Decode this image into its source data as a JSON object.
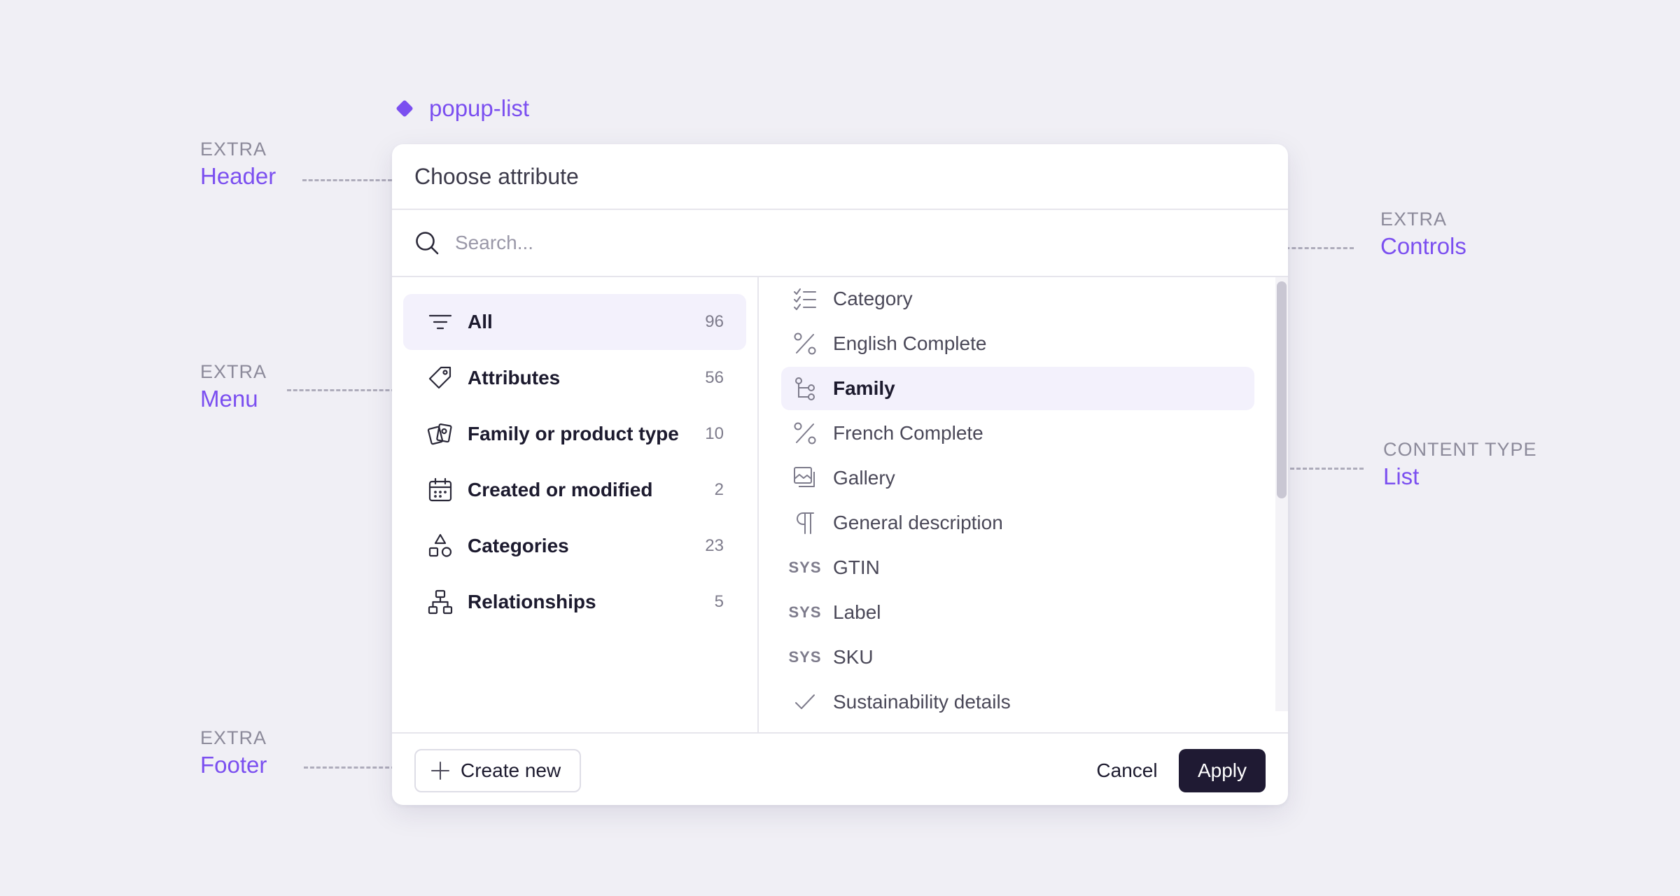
{
  "component": {
    "name": "popup-list"
  },
  "annotations": {
    "header": {
      "caption": "EXTRA",
      "label": "Header"
    },
    "controls": {
      "caption": "EXTRA",
      "label": "Controls"
    },
    "menu": {
      "caption": "EXTRA",
      "label": "Menu"
    },
    "list": {
      "caption": "CONTENT TYPE",
      "label": "List"
    },
    "footer": {
      "caption": "EXTRA",
      "label": "Footer"
    }
  },
  "colors": {
    "accent": "#7b4ff0",
    "selected_bg": "#f3f1fc",
    "primary_button": "#1f1a33"
  },
  "popup": {
    "title": "Choose attribute",
    "search": {
      "placeholder": "Search...",
      "value": ""
    },
    "menu": [
      {
        "label": "All",
        "count": "96",
        "icon": "filter-icon",
        "active": true
      },
      {
        "label": "Attributes",
        "count": "56",
        "icon": "tag-icon"
      },
      {
        "label": "Family or product type",
        "count": "10",
        "icon": "cards-icon"
      },
      {
        "label": "Created or modified",
        "count": "2",
        "icon": "calendar-icon"
      },
      {
        "label": "Categories",
        "count": "23",
        "icon": "shapes-icon"
      },
      {
        "label": "Relationships",
        "count": "5",
        "icon": "hierarchy-icon"
      }
    ],
    "list": [
      {
        "label": "Category",
        "icon": "checklist-icon"
      },
      {
        "label": "English Complete",
        "icon": "percent-icon"
      },
      {
        "label": "Family",
        "icon": "branch-icon",
        "selected": true
      },
      {
        "label": "French Complete",
        "icon": "percent-icon"
      },
      {
        "label": "Gallery",
        "icon": "gallery-icon"
      },
      {
        "label": "General description",
        "icon": "pilcrow-icon"
      },
      {
        "label": "GTIN",
        "icon": "sys-badge",
        "badge": "SYS"
      },
      {
        "label": "Label",
        "icon": "sys-badge",
        "badge": "SYS"
      },
      {
        "label": "SKU",
        "icon": "sys-badge",
        "badge": "SYS"
      },
      {
        "label": "Sustainability details",
        "icon": "check-icon"
      }
    ],
    "footer": {
      "create_label": "Create new",
      "cancel_label": "Cancel",
      "apply_label": "Apply"
    }
  }
}
